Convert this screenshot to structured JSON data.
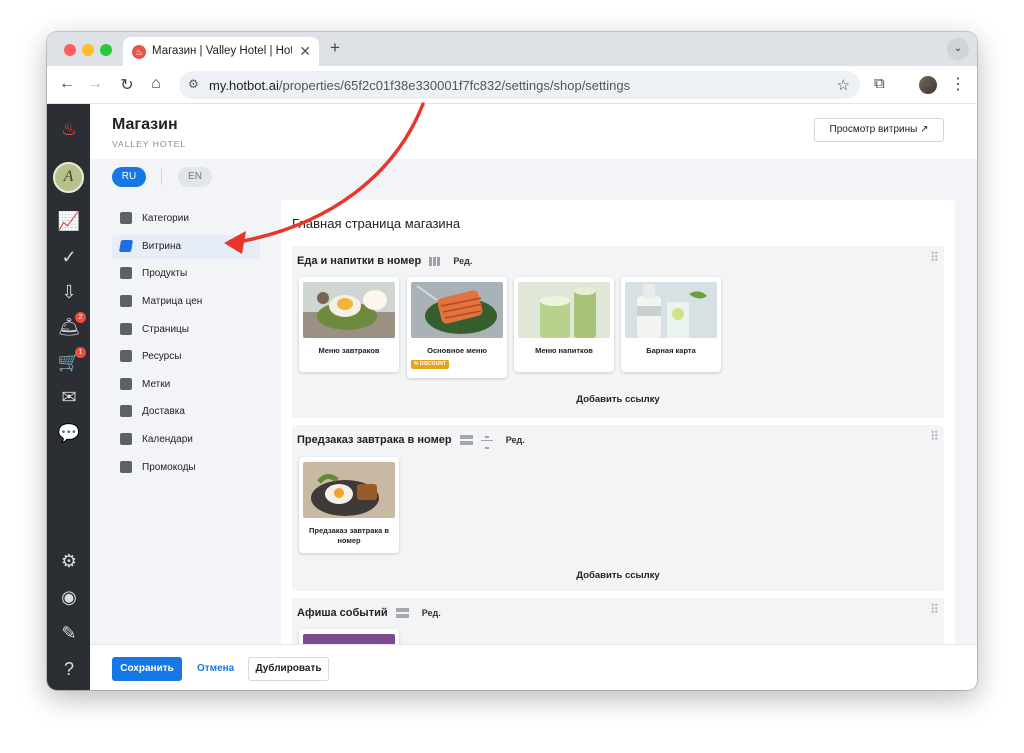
{
  "browser": {
    "tab_title": "Магазин | Valley Hotel | Hotbot",
    "tab_close": "✕",
    "new_tab": "+",
    "tab_menu": "⌄",
    "url_host": "my.hotbot.ai",
    "url_path": "/properties/65f2c01f38e330001f7fc832/settings/shop/settings",
    "icons": [
      "back-icon",
      "forward-icon",
      "reload-icon",
      "home-icon",
      "site-settings-icon",
      "star-icon",
      "extensions-icon",
      "profile-avatar",
      "more-menu-icon"
    ]
  },
  "rail": {
    "icons": [
      "hotbot-logo-icon",
      "avatar",
      "analytics-icon",
      "check-circle-icon",
      "inbox-icon",
      "room-service-icon",
      "cart-icon",
      "mail-icon",
      "chat-icon",
      "settings-icon",
      "user-circle-icon",
      "pencil-icon",
      "help-icon"
    ],
    "room_service_badge": "2",
    "cart_badge": "1"
  },
  "header": {
    "title": "Магазин",
    "subtitle": "VALLEY HOTEL",
    "preview_button": "Просмотр витрины ↗"
  },
  "languages": {
    "ru": "RU",
    "en": "EN"
  },
  "sidebar": {
    "items": [
      {
        "label": "Категории",
        "icon": "categories-icon"
      },
      {
        "label": "Витрина",
        "icon": "showcase-icon",
        "active": true
      },
      {
        "label": "Продукты",
        "icon": "products-icon"
      },
      {
        "label": "Матрица цен",
        "icon": "price-matrix-icon"
      },
      {
        "label": "Страницы",
        "icon": "pages-icon"
      },
      {
        "label": "Ресурсы",
        "icon": "resources-icon"
      },
      {
        "label": "Метки",
        "icon": "tags-icon"
      },
      {
        "label": "Доставка",
        "icon": "delivery-icon"
      },
      {
        "label": "Календари",
        "icon": "calendar-icon"
      },
      {
        "label": "Промокоды",
        "icon": "promo-codes-icon"
      }
    ]
  },
  "main": {
    "title": "Главная страница магазина",
    "sections": [
      {
        "title": "Еда и напитки в номер",
        "edit": "Ред.",
        "add_link": "Добавить ссылку",
        "cards": [
          {
            "label": "Меню завтраков"
          },
          {
            "label": "Основное меню",
            "badge": "% DISCOUNT"
          },
          {
            "label": "Меню напитков"
          },
          {
            "label": "Барная карта"
          }
        ]
      },
      {
        "title": "Предзаказ завтрака в номер",
        "edit": "Ред.",
        "add_link": "Добавить ссылку",
        "cards": [
          {
            "label": "Предзаказ завтрака в номер"
          }
        ]
      },
      {
        "title": "Афиша событий",
        "edit": "Ред."
      }
    ]
  },
  "footer": {
    "save": "Сохранить",
    "cancel": "Отмена",
    "duplicate": "Дублировать"
  },
  "colors": {
    "accent": "#1778e5",
    "rail_bg": "#2b2e33",
    "annotation_arrow": "#e8362a",
    "badge": "#ef4b3e",
    "discount": "#e9a21f"
  }
}
